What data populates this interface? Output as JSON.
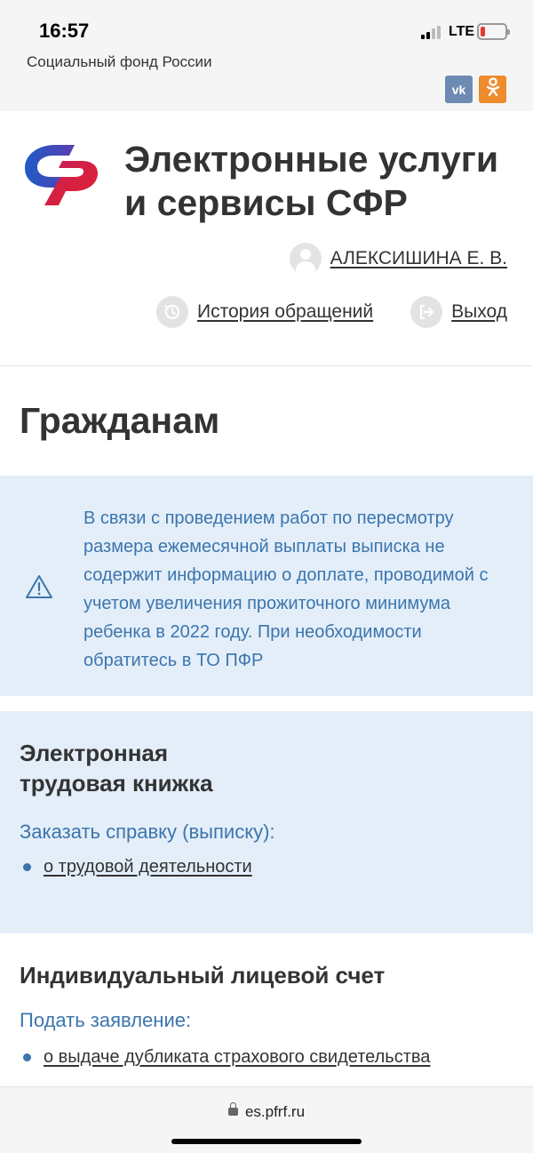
{
  "status_bar": {
    "time": "16:57",
    "network": "LTE"
  },
  "top_strip": {
    "fund_name": "Социальный фонд России",
    "social": [
      {
        "name": "vk",
        "label": "vk"
      },
      {
        "name": "ok",
        "label": "ок"
      }
    ]
  },
  "header": {
    "site_title": "Электронные услуги и сервисы СФР",
    "user_name": "АЛЕКСИШИНА Е. В.",
    "history_label": "История обращений",
    "logout_label": "Выход"
  },
  "page": {
    "title": "Гражданам"
  },
  "notice": {
    "text": "В связи с проведением работ по пересмотру размера ежемесячной выплаты выписка не содержит информацию о доплате, проводимой с учетом увеличения прожиточного минимума ребенка в 2022 году. При необходимости обратитесь в ТО ПФР"
  },
  "sections": [
    {
      "title_line1": "Электронная",
      "title_line2": "трудовая книжка",
      "subtitle": "Заказать справку (выписку):",
      "links": [
        "о трудовой деятельности"
      ]
    },
    {
      "title_line1": "Индивидуальный лицевой счет",
      "subtitle": "Подать заявление:",
      "links": [
        "о выдаче дубликата страхового свидетельства"
      ]
    }
  ],
  "browser": {
    "url": "es.pfrf.ru"
  },
  "colors": {
    "accent_blue": "#3c75ad",
    "panel_bg": "#e3eef9",
    "logo_red": "#e4202c",
    "logo_blue": "#1e5bc6"
  }
}
